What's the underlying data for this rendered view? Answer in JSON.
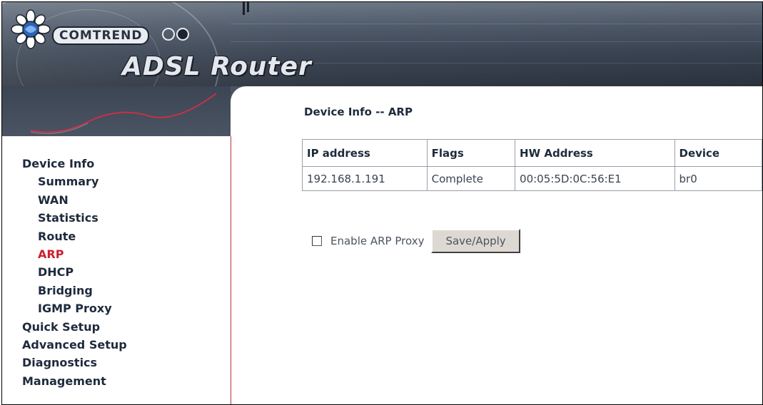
{
  "header": {
    "brand": "COMTREND",
    "product": "ADSL Router"
  },
  "sidebar": {
    "items": [
      {
        "label": "Device Info",
        "level": 0
      },
      {
        "label": "Summary",
        "level": 1
      },
      {
        "label": "WAN",
        "level": 1
      },
      {
        "label": "Statistics",
        "level": 1
      },
      {
        "label": "Route",
        "level": 1
      },
      {
        "label": "ARP",
        "level": 1,
        "active": true
      },
      {
        "label": "DHCP",
        "level": 1
      },
      {
        "label": "Bridging",
        "level": 1
      },
      {
        "label": "IGMP Proxy",
        "level": 1
      },
      {
        "label": "Quick Setup",
        "level": 0
      },
      {
        "label": "Advanced Setup",
        "level": 0
      },
      {
        "label": "Diagnostics",
        "level": 0
      },
      {
        "label": "Management",
        "level": 0
      }
    ]
  },
  "main": {
    "title": "Device Info -- ARP",
    "table": {
      "headers": [
        "IP address",
        "Flags",
        "HW Address",
        "Device"
      ],
      "rows": [
        [
          "192.168.1.191",
          "Complete",
          "00:05:5D:0C:56:E1",
          "br0"
        ]
      ]
    },
    "proxy_label": "Enable ARP Proxy",
    "proxy_checked": false,
    "save_label": "Save/Apply"
  },
  "colors": {
    "active_menu": "#cc2030",
    "menu_text": "#1e2a3c",
    "sidebar_border": "#c0303a"
  }
}
